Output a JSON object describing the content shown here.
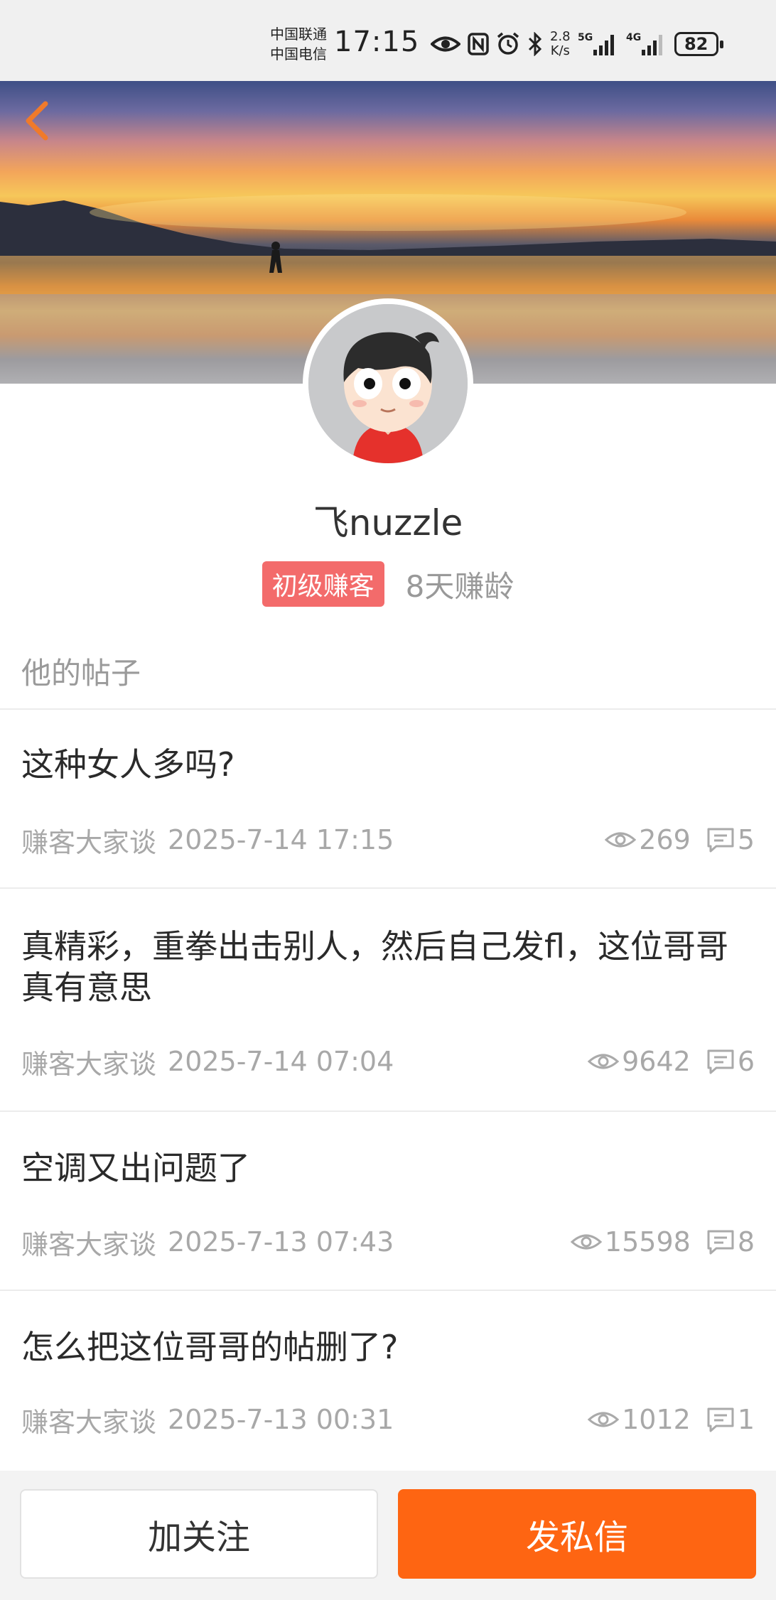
{
  "status_bar": {
    "carrier_1": "中国联通",
    "carrier_2": "中国电信",
    "time": "17:15",
    "net_speed_value": "2.8",
    "net_speed_unit": "K/s",
    "signal_1_label": "5G",
    "signal_2_label": "4G",
    "battery": "82"
  },
  "profile": {
    "username": "飞nuzzle",
    "rank_badge": "初级赚客",
    "member_age": "8天赚龄"
  },
  "posts_section": {
    "title": "他的帖子",
    "posts": [
      {
        "title": "这种女人多吗?",
        "category": "赚客大家谈",
        "datetime": "2025-7-14 17:15",
        "views": "269",
        "comments": "5"
      },
      {
        "title": "真精彩，重拳出击别人，然后自己发fl，这位哥哥真有意思",
        "category": "赚客大家谈",
        "datetime": "2025-7-14 07:04",
        "views": "9642",
        "comments": "6"
      },
      {
        "title": "空调又出问题了",
        "category": "赚客大家谈",
        "datetime": "2025-7-13 07:43",
        "views": "15598",
        "comments": "8"
      },
      {
        "title": "怎么把这位哥哥的帖删了?",
        "category": "赚客大家谈",
        "datetime": "2025-7-13 00:31",
        "views": "1012",
        "comments": "1"
      }
    ]
  },
  "actions": {
    "follow_label": "加关注",
    "message_label": "发私信"
  },
  "colors": {
    "accent": "#fe6512",
    "rank_badge": "#f36b6b",
    "back_arrow": "#f07a2a"
  }
}
